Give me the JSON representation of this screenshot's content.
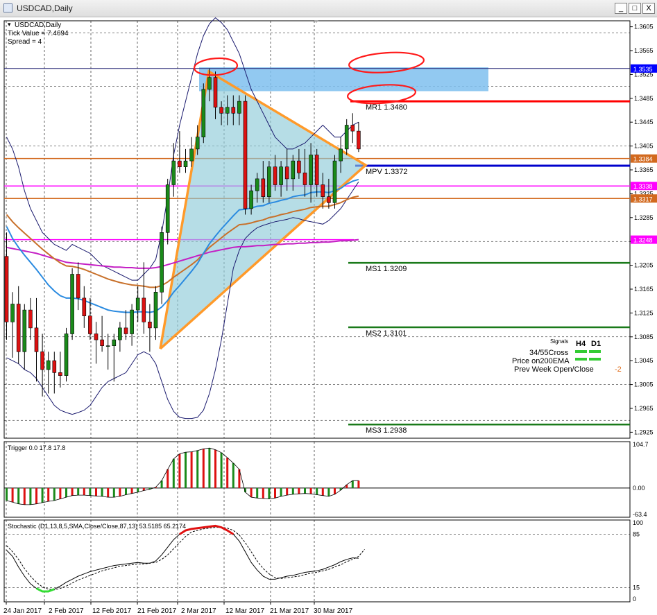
{
  "window": {
    "title": "USDCAD,Daily",
    "buttons": [
      "_",
      "□",
      "X"
    ]
  },
  "info": {
    "symbol_line": "USDCAD,Daily",
    "tick_value": "Tick Value = 7.4694",
    "spread": "Spread = 4"
  },
  "price_axis_ticks": [
    "1.3605",
    "1.3565",
    "1.3525",
    "1.3485",
    "1.3445",
    "1.3405",
    "1.3365",
    "1.3325",
    "1.3285",
    "1.3245",
    "1.3205",
    "1.3165",
    "1.3125",
    "1.3085",
    "1.3045",
    "1.3005",
    "1.2965",
    "1.2925"
  ],
  "price_tags": [
    {
      "label": "1.3535",
      "color": "#0000ff"
    },
    {
      "label": "1.3384",
      "color": "#d2691e"
    },
    {
      "label": "1.3338",
      "color": "#ff00ff"
    },
    {
      "label": "1.3317",
      "color": "#d2691e"
    },
    {
      "label": "1.3248",
      "color": "#ff00ff"
    }
  ],
  "pivots": [
    {
      "label": "MR1",
      "value": "1.3480",
      "color": "#ff0000"
    },
    {
      "label": "MPV",
      "value": "1.3372",
      "color": "#0000cc"
    },
    {
      "label": "MS1",
      "value": "1.3209",
      "color": "#1a7a1a"
    },
    {
      "label": "MS2",
      "value": "1.3101",
      "color": "#1a7a1a"
    },
    {
      "label": "MS3",
      "value": "1.2938",
      "color": "#1a7a1a"
    }
  ],
  "signals": {
    "header": "Signals",
    "cols": [
      "H4",
      "D1"
    ],
    "rows": [
      "34/55Cross",
      "Price on200EMA",
      "Prev Week Open/Close"
    ],
    "prev_week_value": "-2"
  },
  "trigger": {
    "label": "Trigger 0.0 17.8 17.8",
    "ticks": [
      "104.7",
      "0.00",
      "-63.4"
    ]
  },
  "stochastic": {
    "label": "Stochastic (D1,13,8,5,SMA,Close/Close,87,13) 53.5185 65.2174",
    "ticks": [
      "100",
      "85",
      "15",
      "0"
    ]
  },
  "date_labels": [
    "24 Jan 2017",
    "2 Feb 2017",
    "12 Feb 2017",
    "21 Feb 2017",
    "2 Mar 2017",
    "12 Mar 2017",
    "21 Mar 2017",
    "30 Mar 2017"
  ],
  "chart_data": {
    "type": "candlestick",
    "title": "USDCAD,Daily",
    "ylim": [
      1.2915,
      1.3615
    ],
    "colors": {
      "up": "#1a8a1a",
      "down": "#dd1111",
      "ema34": "#2b8be0",
      "ema55": "#c8702a",
      "ema200": "#c41fc4",
      "bands": "#1a1a6e",
      "wedge": "#ff9a2a",
      "box": "#7fbfee"
    },
    "candles": [
      [
        1.322,
        1.326,
        1.308,
        1.311
      ],
      [
        1.311,
        1.316,
        1.305,
        1.314
      ],
      [
        1.314,
        1.317,
        1.304,
        1.306
      ],
      [
        1.306,
        1.314,
        1.303,
        1.313
      ],
      [
        1.313,
        1.315,
        1.308,
        1.31
      ],
      [
        1.31,
        1.315,
        1.301,
        1.306
      ],
      [
        1.306,
        1.309,
        1.2985,
        1.303
      ],
      [
        1.303,
        1.306,
        1.299,
        1.3045
      ],
      [
        1.3045,
        1.306,
        1.299,
        1.3025
      ],
      [
        1.3025,
        1.306,
        1.3,
        1.302
      ],
      [
        1.302,
        1.31,
        1.301,
        1.309
      ],
      [
        1.309,
        1.32,
        1.308,
        1.319
      ],
      [
        1.319,
        1.321,
        1.313,
        1.315
      ],
      [
        1.315,
        1.317,
        1.31,
        1.312
      ],
      [
        1.312,
        1.315,
        1.308,
        1.309
      ],
      [
        1.309,
        1.311,
        1.304,
        1.308
      ],
      [
        1.308,
        1.312,
        1.306,
        1.307
      ],
      [
        1.307,
        1.309,
        1.303,
        1.307
      ],
      [
        1.307,
        1.309,
        1.301,
        1.308
      ],
      [
        1.308,
        1.311,
        1.306,
        1.31
      ],
      [
        1.31,
        1.313,
        1.308,
        1.309
      ],
      [
        1.309,
        1.314,
        1.307,
        1.313
      ],
      [
        1.313,
        1.317,
        1.311,
        1.315
      ],
      [
        1.315,
        1.321,
        1.309,
        1.311
      ],
      [
        1.311,
        1.314,
        1.306,
        1.31
      ],
      [
        1.31,
        1.317,
        1.308,
        1.316
      ],
      [
        1.316,
        1.327,
        1.314,
        1.326
      ],
      [
        1.326,
        1.335,
        1.324,
        1.334
      ],
      [
        1.334,
        1.341,
        1.332,
        1.338
      ],
      [
        1.338,
        1.343,
        1.336,
        1.337
      ],
      [
        1.337,
        1.34,
        1.336,
        1.338
      ],
      [
        1.338,
        1.342,
        1.337,
        1.34
      ],
      [
        1.34,
        1.344,
        1.339,
        1.342
      ],
      [
        1.342,
        1.351,
        1.341,
        1.35
      ],
      [
        1.35,
        1.3535,
        1.348,
        1.352
      ],
      [
        1.352,
        1.353,
        1.345,
        1.347
      ],
      [
        1.347,
        1.348,
        1.344,
        1.346
      ],
      [
        1.346,
        1.349,
        1.344,
        1.347
      ],
      [
        1.347,
        1.349,
        1.344,
        1.346
      ],
      [
        1.346,
        1.349,
        1.344,
        1.348
      ],
      [
        1.348,
        1.349,
        1.329,
        1.33
      ],
      [
        1.33,
        1.334,
        1.329,
        1.333
      ],
      [
        1.333,
        1.336,
        1.331,
        1.335
      ],
      [
        1.335,
        1.338,
        1.331,
        1.332
      ],
      [
        1.332,
        1.338,
        1.331,
        1.337
      ],
      [
        1.337,
        1.339,
        1.333,
        1.334
      ],
      [
        1.334,
        1.338,
        1.332,
        1.337
      ],
      [
        1.337,
        1.34,
        1.333,
        1.335
      ],
      [
        1.335,
        1.339,
        1.333,
        1.338
      ],
      [
        1.338,
        1.34,
        1.335,
        1.336
      ],
      [
        1.336,
        1.34,
        1.332,
        1.334
      ],
      [
        1.334,
        1.341,
        1.331,
        1.339
      ],
      [
        1.339,
        1.34,
        1.332,
        1.334
      ],
      [
        1.334,
        1.336,
        1.33,
        1.332
      ],
      [
        1.332,
        1.335,
        1.33,
        1.331
      ],
      [
        1.331,
        1.339,
        1.33,
        1.338
      ],
      [
        1.338,
        1.342,
        1.336,
        1.34
      ],
      [
        1.34,
        1.345,
        1.339,
        1.344
      ],
      [
        1.344,
        1.346,
        1.341,
        1.343
      ],
      [
        1.343,
        1.3445,
        1.3395,
        1.34
      ]
    ],
    "ema34": [
      1.327,
      1.325,
      1.3235,
      1.3222,
      1.321,
      1.3198,
      1.3185,
      1.3172,
      1.3162,
      1.3154,
      1.315,
      1.315,
      1.3149,
      1.3146,
      1.3142,
      1.3138,
      1.3134,
      1.313,
      1.3128,
      1.3127,
      1.3126,
      1.3126,
      1.3127,
      1.3127,
      1.3126,
      1.3128,
      1.3135,
      1.3146,
      1.316,
      1.3171,
      1.3183,
      1.3195,
      1.3208,
      1.3225,
      1.3241,
      1.3254,
      1.3266,
      1.3277,
      1.3288,
      1.3298,
      1.3299,
      1.3301,
      1.3304,
      1.3305,
      1.3309,
      1.3311,
      1.3314,
      1.3316,
      1.332,
      1.3322,
      1.3323,
      1.3327,
      1.3328,
      1.3328,
      1.3327,
      1.333,
      1.3334,
      1.3341,
      1.3346,
      1.3349
    ],
    "ema55": [
      1.329,
      1.3278,
      1.3268,
      1.3259,
      1.325,
      1.3241,
      1.3232,
      1.3224,
      1.3216,
      1.3209,
      1.3204,
      1.3203,
      1.3201,
      1.3198,
      1.3194,
      1.319,
      1.3186,
      1.3182,
      1.3179,
      1.3176,
      1.3174,
      1.3172,
      1.3171,
      1.317,
      1.3168,
      1.3168,
      1.3171,
      1.3177,
      1.3185,
      1.3192,
      1.3199,
      1.3206,
      1.3214,
      1.3225,
      1.3235,
      1.3243,
      1.3251,
      1.3259,
      1.3266,
      1.3273,
      1.3274,
      1.3276,
      1.3279,
      1.3281,
      1.3285,
      1.3287,
      1.329,
      1.3292,
      1.3295,
      1.3297,
      1.3299,
      1.3302,
      1.3303,
      1.3304,
      1.3304,
      1.3307,
      1.331,
      1.3315,
      1.3319,
      1.3321
    ],
    "ema200": [
      1.3235,
      1.3233,
      1.3231,
      1.3229,
      1.3227,
      1.3225,
      1.3222,
      1.3219,
      1.3216,
      1.3213,
      1.321,
      1.3209,
      1.3208,
      1.3207,
      1.3206,
      1.3205,
      1.3204,
      1.3203,
      1.3202,
      1.3202,
      1.3201,
      1.3201,
      1.32,
      1.32,
      1.32,
      1.3201,
      1.3203,
      1.3206,
      1.3209,
      1.3212,
      1.3215,
      1.3218,
      1.3221,
      1.3224,
      1.3227,
      1.3229,
      1.3231,
      1.3233,
      1.3235,
      1.3236,
      1.3236,
      1.3237,
      1.3238,
      1.3238,
      1.3239,
      1.324,
      1.324,
      1.3241,
      1.3241,
      1.3242,
      1.3242,
      1.3243,
      1.3243,
      1.3244,
      1.3244,
      1.3245,
      1.3246,
      1.3246,
      1.3247,
      1.3248
    ],
    "band_upper": [
      1.342,
      1.34,
      1.337,
      1.333,
      1.33,
      1.328,
      1.326,
      1.325,
      1.324,
      1.3235,
      1.323,
      1.324,
      1.3235,
      1.323,
      1.3225,
      1.3215,
      1.3205,
      1.32,
      1.3195,
      1.319,
      1.3185,
      1.318,
      1.318,
      1.319,
      1.32,
      1.3215,
      1.326,
      1.332,
      1.339,
      1.344,
      1.348,
      1.352,
      1.356,
      1.359,
      1.361,
      1.362,
      1.3612,
      1.36,
      1.358,
      1.356,
      1.353,
      1.35,
      1.348,
      1.346,
      1.344,
      1.342,
      1.341,
      1.34,
      1.34,
      1.3405,
      1.341,
      1.342,
      1.343,
      1.344,
      1.343,
      1.342,
      1.342,
      1.343,
      1.344,
      1.3445
    ],
    "band_lower": [
      1.305,
      1.3045,
      1.304,
      1.303,
      1.3025,
      1.3015,
      1.3,
      1.2985,
      1.297,
      1.2962,
      1.2958,
      1.2955,
      1.2958,
      1.2962,
      1.297,
      1.2985,
      1.3,
      1.301,
      1.3015,
      1.302,
      1.3025,
      1.304,
      1.3055,
      1.306,
      1.3055,
      1.304,
      1.301,
      1.298,
      1.296,
      1.295,
      1.2948,
      1.2948,
      1.295,
      1.2962,
      1.299,
      1.303,
      1.308,
      1.314,
      1.32,
      1.323,
      1.325,
      1.326,
      1.3268,
      1.3272,
      1.3275,
      1.3278,
      1.328,
      1.3282,
      1.3285,
      1.3283,
      1.328,
      1.3278,
      1.3276,
      1.3274,
      1.328,
      1.329,
      1.33,
      1.3315,
      1.333,
      1.3345
    ],
    "trigger": [
      -30,
      -34,
      -38,
      -40,
      -40,
      -38,
      -35,
      -32,
      -30,
      -26,
      -22,
      -18,
      -17,
      -17,
      -18,
      -19,
      -20,
      -22,
      -22,
      -20,
      -16,
      -13,
      -10,
      -6,
      -3,
      2,
      18,
      45,
      70,
      82,
      86,
      87,
      90,
      94,
      96,
      92,
      85,
      73,
      60,
      45,
      -10,
      -22,
      -24,
      -25,
      -26,
      -24,
      -20,
      -17,
      -15,
      -14,
      -13,
      -14,
      -16,
      -18,
      -20,
      -15,
      -5,
      8,
      17.8,
      17.8
    ],
    "stoch_main": [
      64,
      56,
      42,
      30,
      20,
      14,
      10,
      10,
      13,
      17,
      22,
      26,
      30,
      33,
      36,
      38,
      40,
      42,
      44,
      45,
      46,
      47,
      48,
      47,
      47,
      50,
      58,
      68,
      78,
      85,
      90,
      92,
      93,
      94,
      95,
      96,
      94,
      90,
      85,
      76,
      62,
      48,
      38,
      30,
      26,
      26,
      28,
      30,
      31,
      33,
      35,
      36,
      37,
      39,
      42,
      45,
      49,
      52,
      54,
      53.5
    ],
    "stoch_signal": [
      70,
      62,
      52,
      40,
      30,
      22,
      16,
      13,
      12,
      14,
      17,
      21,
      25,
      28,
      31,
      34,
      37,
      39,
      41,
      43,
      44,
      45,
      46,
      46,
      47,
      48,
      52,
      58,
      66,
      74,
      82,
      88,
      90,
      92,
      93,
      94,
      94,
      93,
      90,
      84,
      74,
      62,
      50,
      40,
      33,
      28,
      27,
      28,
      29,
      30,
      32,
      34,
      35,
      37,
      39,
      42,
      45,
      49,
      52,
      56,
      65.2
    ]
  }
}
